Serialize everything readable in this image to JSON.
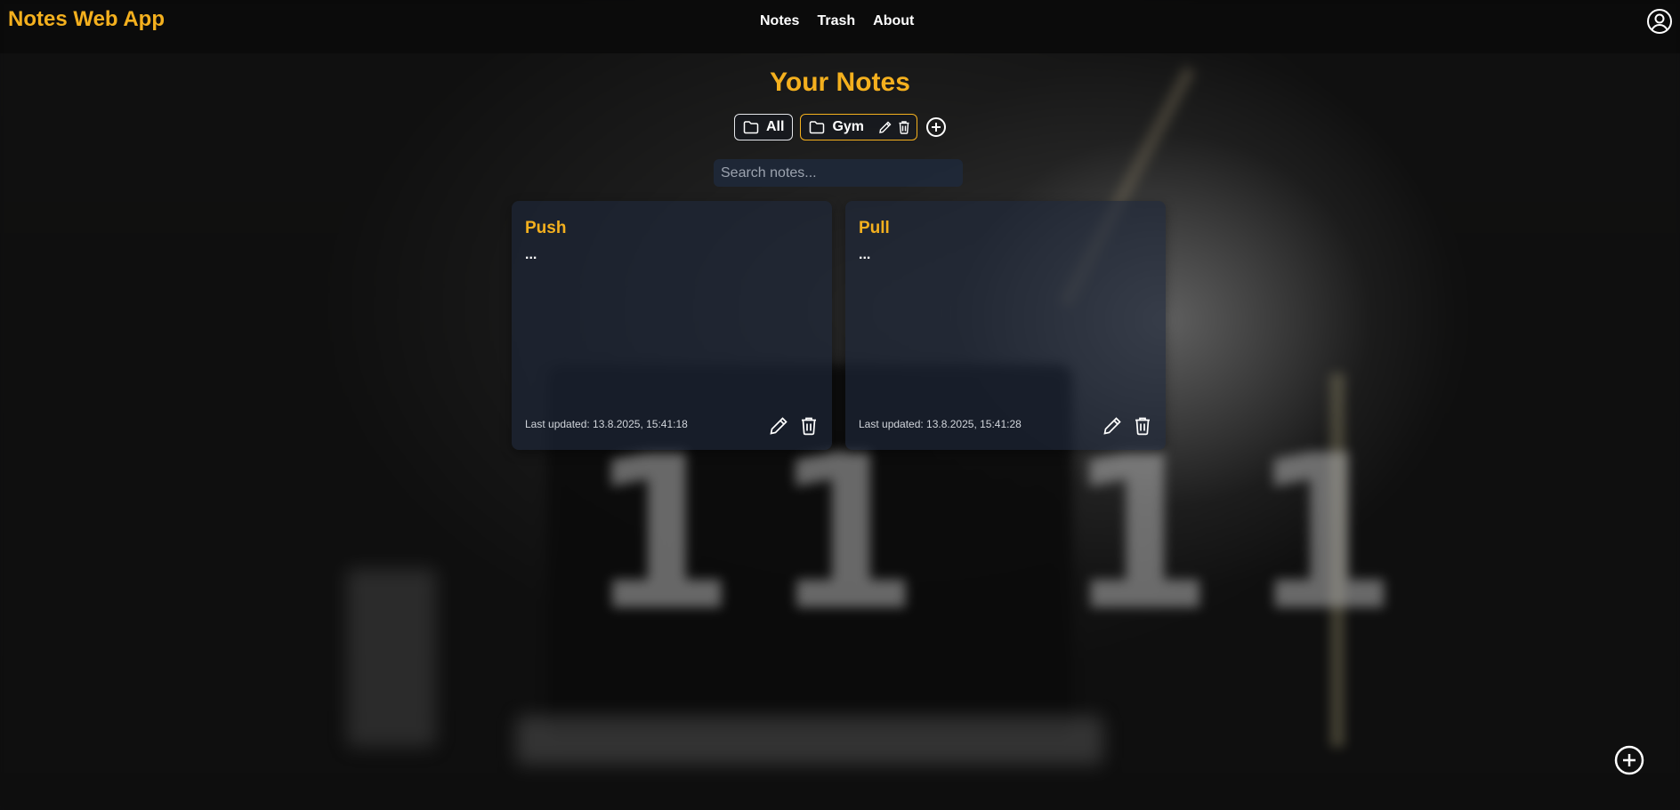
{
  "app": {
    "brand": "Notes Web App",
    "accent_color": "#f4b01e"
  },
  "nav": {
    "links": [
      {
        "label": "Notes"
      },
      {
        "label": "Trash"
      },
      {
        "label": "About"
      }
    ],
    "profile_icon": "user-circle-icon"
  },
  "page": {
    "title": "Your Notes"
  },
  "folders": {
    "items": [
      {
        "label": "All",
        "icon": "folder-icon",
        "selected": true
      },
      {
        "label": "Gym",
        "icon": "folder-icon",
        "actions": [
          "pencil-icon",
          "trash-icon"
        ]
      }
    ],
    "add_icon": "plus-circle-icon"
  },
  "search": {
    "placeholder": "Search notes...",
    "value": ""
  },
  "notes": [
    {
      "title": "Push",
      "preview": "...",
      "updated": "Last updated: 13.8.2025, 15:41:18"
    },
    {
      "title": "Pull",
      "preview": "...",
      "updated": "Last updated: 13.8.2025, 15:41:28"
    }
  ],
  "fab": {
    "icon": "plus-circle-icon"
  }
}
